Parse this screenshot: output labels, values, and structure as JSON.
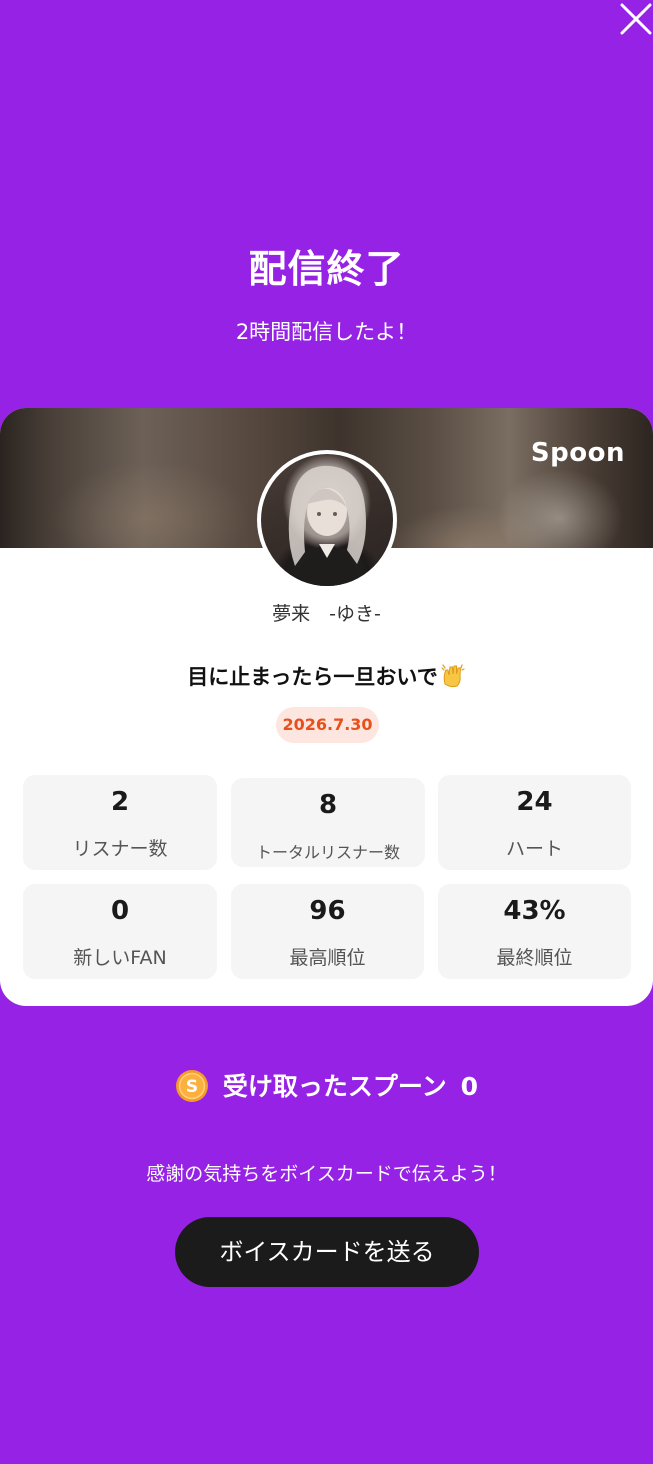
{
  "close": {
    "icon": "close-icon"
  },
  "header": {
    "title": "配信終了",
    "subtitle": "2時間配信したよ！"
  },
  "card": {
    "brand": "Spoon",
    "streamer_name": "夢来　-ゆき-",
    "stream_title": "目に止まったら一旦おいで",
    "stream_title_emoji": "clapping-hands-icon",
    "date": "2026.7.30",
    "stats": [
      {
        "value": "2",
        "label": "リスナー数"
      },
      {
        "value": "8",
        "label": "トータルリスナー数"
      },
      {
        "value": "24",
        "label": "ハート"
      },
      {
        "value": "0",
        "label": "新しいFAN"
      },
      {
        "value": "96",
        "label": "最高順位"
      },
      {
        "value": "43%",
        "label": "最終順位"
      }
    ]
  },
  "spoons": {
    "icon": "spoon-coin-icon",
    "label": "受け取ったスプーン",
    "count": "0"
  },
  "footer": {
    "message": "感謝の気持ちをボイスカードで伝えよう！",
    "button_label": "ボイスカードを送る"
  },
  "colors": {
    "background": "#9622e6",
    "date_badge_bg": "#fde6df",
    "date_badge_text": "#e8501b",
    "button_bg": "#1b1b1b",
    "coin": "#f59a2d"
  }
}
